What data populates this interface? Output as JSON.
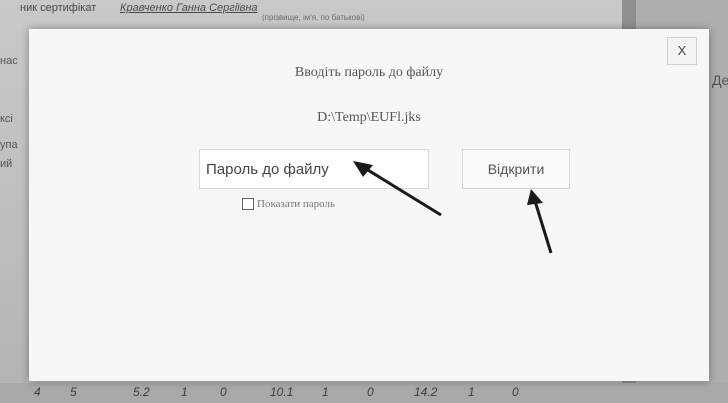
{
  "background": {
    "cert_label": "ник сертифікат",
    "holder_name": "Кравченко Ганна Сергіївна",
    "holder_caption": "(прізвище, ім'я, по батькові)",
    "left_fragments": [
      "нас",
      "ксі",
      "упа",
      "ий"
    ],
    "right_fragment": "Де",
    "bottom_row": [
      "4",
      "5",
      "5.2",
      "1",
      "0",
      "10.1",
      "1",
      "0",
      "14.2",
      "1",
      "0"
    ]
  },
  "dialog": {
    "close_label": "X",
    "title": "Вводіть пароль до файлу",
    "file_path": "D:\\Temp\\EUFl.jks",
    "password_placeholder": "Пароль до файлу",
    "open_button": "Відкрити",
    "show_password_label": "Показати пароль",
    "show_password_checked": false
  }
}
